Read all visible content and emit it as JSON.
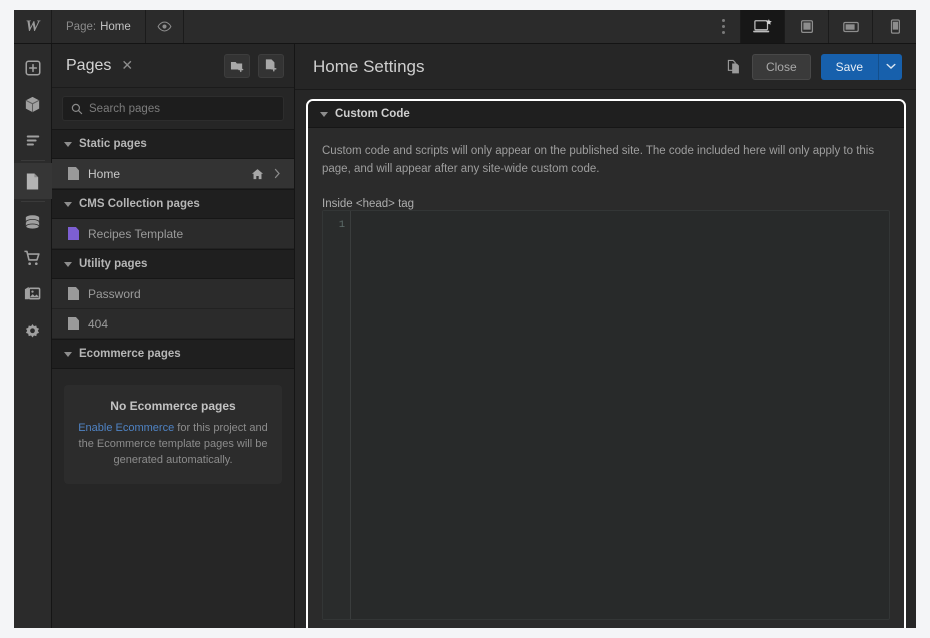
{
  "topbar": {
    "logo": "W",
    "page_label": "Page:",
    "page_value": "Home",
    "preview_icon": "eye-icon",
    "menu_icon": "more-vertical-icon",
    "breakpoints": [
      {
        "name": "desktop",
        "icon": "laptop-star-icon",
        "active": true
      },
      {
        "name": "tablet",
        "icon": "tablet-portrait-icon",
        "active": false
      },
      {
        "name": "mobile-landscape",
        "icon": "mobile-landscape-icon",
        "active": false
      },
      {
        "name": "mobile-portrait",
        "icon": "mobile-portrait-icon",
        "active": false
      }
    ]
  },
  "rail": {
    "items": [
      {
        "name": "add-panel",
        "icon": "plus-box-icon",
        "active": false
      },
      {
        "name": "components",
        "icon": "cube-icon",
        "active": false
      },
      {
        "name": "navigator",
        "icon": "layers-lines-icon",
        "active": false
      },
      {
        "name": "pages",
        "icon": "page-icon",
        "active": true
      },
      {
        "name": "cms",
        "icon": "database-icon",
        "active": false
      },
      {
        "name": "ecommerce",
        "icon": "shopping-cart-icon",
        "active": false
      },
      {
        "name": "assets",
        "icon": "images-icon",
        "active": false
      },
      {
        "name": "settings",
        "icon": "gear-icon",
        "active": false
      }
    ]
  },
  "pages_panel": {
    "title": "Pages",
    "close_icon": "✕",
    "new_folder_icon": "folder-plus-icon",
    "new_page_icon": "page-plus-icon",
    "search": {
      "placeholder": "Search pages",
      "value": ""
    },
    "groups": [
      {
        "label": "Static pages",
        "expanded": true,
        "pages": [
          {
            "label": "Home",
            "icon": "page-icon",
            "home": true,
            "chevron": true,
            "hover": true
          }
        ]
      },
      {
        "label": "CMS Collection pages",
        "expanded": true,
        "pages": [
          {
            "label": "Recipes Template",
            "icon": "cms-page-icon",
            "home": false,
            "chevron": false,
            "hover": false
          }
        ]
      },
      {
        "label": "Utility pages",
        "expanded": true,
        "pages": [
          {
            "label": "Password",
            "icon": "page-icon",
            "home": false,
            "chevron": false,
            "hover": false
          },
          {
            "label": "404",
            "icon": "page-icon",
            "home": false,
            "chevron": false,
            "hover": false
          }
        ]
      },
      {
        "label": "Ecommerce pages",
        "expanded": true,
        "pages": []
      }
    ],
    "ecommerce_empty": {
      "title": "No Ecommerce pages",
      "link": "Enable Ecommerce",
      "text": " for this project and the Ecommerce template pages will be generated automatically."
    }
  },
  "settings": {
    "title": "Home Settings",
    "duplicate_icon": "duplicate-icon",
    "close_label": "Close",
    "save_label": "Save",
    "save_caret_icon": "chevron-down-icon",
    "custom_code": {
      "header": "Custom Code",
      "description": "Custom code and scripts will only appear on the published site. The code included here will only apply to this page, and will appear after any site-wide custom code.",
      "field_label": "Inside <head> tag",
      "editor": {
        "line_number": "1",
        "value": ""
      }
    }
  },
  "colors": {
    "accent_blue": "#1760ac",
    "link_blue": "#4f83c4",
    "cms_purple": "#7d5fd3",
    "highlight_border": "#ffffff",
    "panel_bg": "#262626",
    "app_bg": "#1f1f1f"
  }
}
